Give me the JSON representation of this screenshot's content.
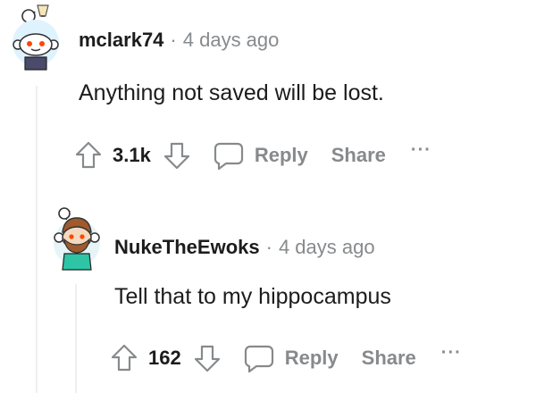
{
  "comments": [
    {
      "username": "mclark74",
      "separator": "·",
      "time": "4 days ago",
      "body": "Anything not saved will be lost.",
      "score": "3.1k",
      "reply_label": "Reply",
      "share_label": "Share",
      "more_label": "···",
      "avatar_icon": "snoo-avatar-icon"
    },
    {
      "username": "NukeTheEwoks",
      "separator": "·",
      "time": "4 days ago",
      "body": "Tell that to my hippocampus",
      "score": "162",
      "reply_label": "Reply",
      "share_label": "Share",
      "more_label": "···",
      "avatar_icon": "snoo-avatar-icon"
    }
  ],
  "colors": {
    "text": "#1c1c1c",
    "meta": "#878a8c",
    "thread_line": "#edeff1"
  }
}
